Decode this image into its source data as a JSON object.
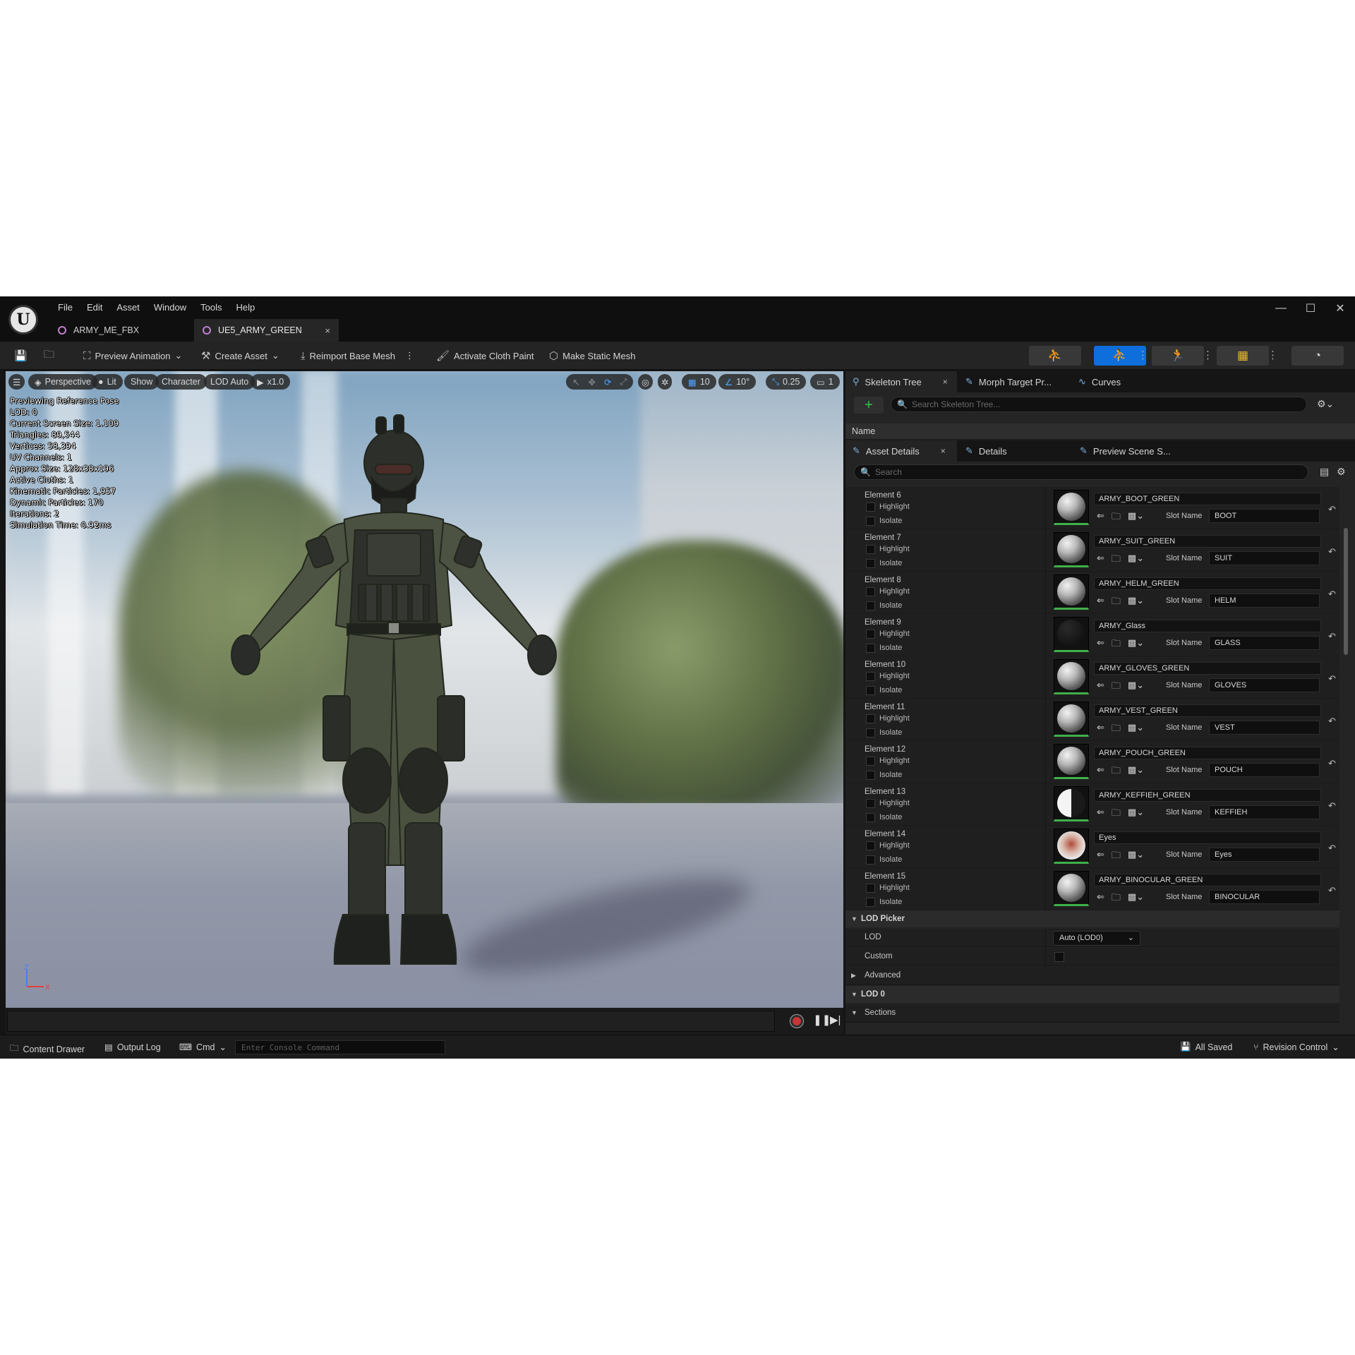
{
  "menu": [
    "File",
    "Edit",
    "Asset",
    "Window",
    "Tools",
    "Help"
  ],
  "doc_tabs": [
    {
      "label": "ARMY_ME_FBX"
    },
    {
      "label": "UE5_ARMY_GREEN",
      "close": "×"
    }
  ],
  "toolbar": {
    "preview_animation": "Preview Animation",
    "create_asset": "Create Asset",
    "reimport": "Reimport Base Mesh",
    "cloth_paint": "Activate Cloth Paint",
    "static_mesh": "Make Static Mesh"
  },
  "viewport": {
    "toolbar": {
      "perspective": "Perspective",
      "lit": "Lit",
      "show": "Show",
      "character": "Character",
      "lod": "LOD Auto",
      "speed": "x1.0",
      "grid": "10",
      "angle": "10°",
      "scale": "0.25",
      "camera": "1"
    },
    "stats": [
      "Previewing Reference Pose",
      "LOD: 0",
      "Current Screen Size: 1.109",
      "Triangles: 89,544",
      "Vertices: 58,394",
      "UV Channels: 1",
      "Approx Size: 128x38x196",
      "Active Cloths: 1",
      "Kinematic Particles: 1,957",
      "Dynamic Particles: 170",
      "Iterations: 2",
      "Simulation Time: 0.92ms"
    ],
    "axis": {
      "z": "Z",
      "x": "X"
    }
  },
  "panels": {
    "top_tabs": [
      {
        "label": "Skeleton Tree",
        "close": "×"
      },
      {
        "label": "Morph Target Pr..."
      },
      {
        "label": "Curves"
      }
    ],
    "skeleton_search_placeholder": "Search Skeleton Tree...",
    "skeleton_name_header": "Name",
    "bottom_tabs": [
      {
        "label": "Asset Details",
        "close": "×"
      },
      {
        "label": "Details"
      },
      {
        "label": "Preview Scene S..."
      }
    ],
    "details_search_placeholder": "Search"
  },
  "element_labels": {
    "highlight": "Highlight",
    "isolate": "Isolate",
    "slot_name": "Slot Name"
  },
  "elements": [
    {
      "name": "Element 6",
      "material": "ARMY_BOOT_GREEN",
      "slot": "BOOT",
      "thumb": "light"
    },
    {
      "name": "Element 7",
      "material": "ARMY_SUIT_GREEN",
      "slot": "SUIT",
      "thumb": "light"
    },
    {
      "name": "Element 8",
      "material": "ARMY_HELM_GREEN",
      "slot": "HELM",
      "thumb": "light"
    },
    {
      "name": "Element 9",
      "material": "ARMY_Glass",
      "slot": "GLASS",
      "thumb": "dark"
    },
    {
      "name": "Element 10",
      "material": "ARMY_GLOVES_GREEN",
      "slot": "GLOVES",
      "thumb": "light"
    },
    {
      "name": "Element 11",
      "material": "ARMY_VEST_GREEN",
      "slot": "VEST",
      "thumb": "light"
    },
    {
      "name": "Element 12",
      "material": "ARMY_POUCH_GREEN",
      "slot": "POUCH",
      "thumb": "light"
    },
    {
      "name": "Element 13",
      "material": "ARMY_KEFFIEH_GREEN",
      "slot": "KEFFIEH",
      "thumb": "half"
    },
    {
      "name": "Element 14",
      "material": "Eyes",
      "slot": "Eyes",
      "thumb": "eye"
    },
    {
      "name": "Element 15",
      "material": "ARMY_BINOCULAR_GREEN",
      "slot": "BINOCULAR",
      "thumb": "light"
    }
  ],
  "lod_picker": {
    "header": "LOD Picker",
    "lod_label": "LOD",
    "lod_value": "Auto (LOD0)",
    "custom_label": "Custom",
    "advanced_label": "Advanced"
  },
  "lod0": {
    "header": "LOD 0",
    "sections_label": "Sections"
  },
  "statusbar": {
    "content_drawer": "Content Drawer",
    "output_log": "Output Log",
    "cmd": "Cmd",
    "console_placeholder": "Enter Console Command",
    "all_saved": "All Saved",
    "revision_control": "Revision Control"
  },
  "colors": {
    "accent_blue": "#0e6fdc",
    "thumb_underline": "#3fb04a",
    "record_red": "#c63636"
  }
}
